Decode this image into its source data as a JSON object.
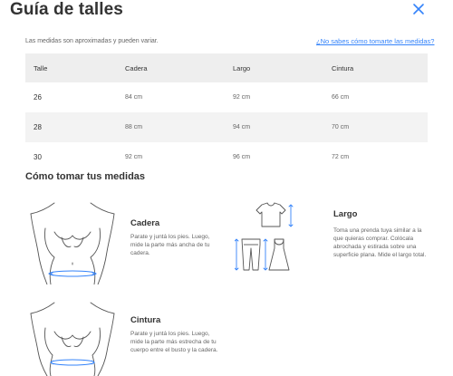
{
  "header": {
    "title": "Guía de talles",
    "close_icon": "close-icon"
  },
  "intro": {
    "note": "Las medidas son aproximadas y pueden variar.",
    "help_link": "¿No sabes cómo tomarte las medidas?"
  },
  "colors": {
    "accent": "#3483fa",
    "header_bg": "#eeeeee",
    "row_shade": "#f3f3f3",
    "text": "#333333",
    "muted": "#666666"
  },
  "table": {
    "headers": [
      "Talle",
      "Cadera",
      "Largo",
      "Cintura"
    ],
    "rows": [
      [
        "26",
        "84 cm",
        "92 cm",
        "66 cm"
      ],
      [
        "28",
        "88 cm",
        "94 cm",
        "70 cm"
      ],
      [
        "30",
        "92 cm",
        "96 cm",
        "72 cm"
      ]
    ]
  },
  "how_to": {
    "title": "Cómo tomar tus medidas",
    "cards": [
      {
        "title": "Cadera",
        "description": "Parate y juntá los pies. Luego, mide la parte más ancha de tu cadera.",
        "icon": "hip-measure-figure-icon"
      },
      {
        "title": "Largo",
        "description": "Toma una prenda tuya similar a la que quieras comprar. Colócala abrochada y estirada sobre una superficie plana. Mide el largo total.",
        "icon": "garment-length-icon"
      },
      {
        "title": "Cintura",
        "description": "Parate y juntá los pies. Luego, mide la parte más estrecha de tu cuerpo entre el busto y la cadera.",
        "icon": "waist-measure-figure-icon"
      }
    ]
  }
}
